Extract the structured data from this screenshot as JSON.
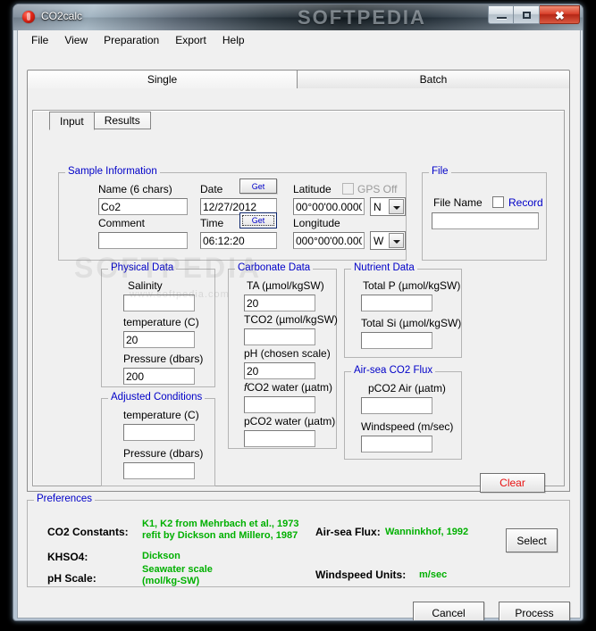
{
  "window": {
    "title": "CO2calc",
    "watermark": "SOFTPEDIA",
    "body_watermark": "SOFTPEDIA",
    "body_watermark_sub": "www.softpedia.com",
    "minimize_label": "–",
    "maximize_label": "□",
    "close_label": "✖"
  },
  "menu": {
    "items": [
      {
        "label": "File"
      },
      {
        "label": "View"
      },
      {
        "label": "Preparation"
      },
      {
        "label": "Export"
      },
      {
        "label": "Help"
      }
    ]
  },
  "outer_tabs": [
    {
      "label": "Single",
      "active": true
    },
    {
      "label": "Batch",
      "active": false
    }
  ],
  "inner_tabs": [
    {
      "label": "Input",
      "active": true
    },
    {
      "label": "Results",
      "active": false
    }
  ],
  "sample_information": {
    "title": "Sample Information",
    "name_label": "Name (6 chars)",
    "name_value": "Co2",
    "comment_label": "Comment",
    "comment_value": "",
    "date_label": "Date",
    "date_value": "12/27/2012",
    "date_get_label": "Get",
    "time_label": "Time",
    "time_value": "06:12:20",
    "time_get_label": "Get",
    "latitude_label": "Latitude",
    "latitude_value": "00°00'00.0000\"",
    "latitude_hemisphere": "N",
    "longitude_label": "Longitude",
    "longitude_value": "000°00'00.0000\"",
    "longitude_hemisphere": "W",
    "gps_label": "GPS Off"
  },
  "file_section": {
    "title": "File",
    "file_name_label": "File Name",
    "record_label": "Record",
    "file_name_value": ""
  },
  "physical_data": {
    "title": "Physical Data",
    "salinity_label": "Salinity",
    "salinity_value": "",
    "temperature_label": "temperature (C)",
    "temperature_value": "20",
    "pressure_label": "Pressure (dbars)",
    "pressure_value": "200"
  },
  "adjusted_conditions": {
    "title": "Adjusted  Conditions",
    "temperature_label": "temperature (C)",
    "temperature_value": "",
    "pressure_label": "Pressure (dbars)",
    "pressure_value": ""
  },
  "carbonate_data": {
    "title": "Carbonate Data",
    "ta_label": "TA (µmol/kgSW)",
    "ta_value": "20",
    "tco2_label": "TCO2 (µmol/kgSW)",
    "tco2_value": "",
    "ph_label": "pH (chosen scale)",
    "ph_value": "20",
    "fco2_label_prefix": "f",
    "fco2_label_rest": "CO2 water (µatm)",
    "fco2_value": "",
    "pco2_label": "pCO2 water (µatm)",
    "pco2_value": ""
  },
  "nutrient_data": {
    "title": "Nutrient Data",
    "total_p_label": "Total P (µmol/kgSW)",
    "total_p_value": "",
    "total_si_label": "Total Si (µmol/kgSW)",
    "total_si_value": ""
  },
  "air_sea_flux": {
    "title": "Air-sea CO2 Flux",
    "pco2_air_label": "pCO2 Air (µatm)",
    "pco2_air_value": "",
    "windspeed_label": "Windspeed (m/sec)",
    "windspeed_value": ""
  },
  "clear_button": {
    "label": "Clear"
  },
  "preferences": {
    "title": "Preferences",
    "co2_constants_label": "CO2 Constants:",
    "co2_constants_value": "K1, K2 from Mehrbach et al., 1973\nrefit by Dickson and Millero, 1987",
    "khso4_label": "KHSO4:",
    "khso4_value": "Dickson",
    "ph_scale_label": "pH Scale:",
    "ph_scale_value": "Seawater scale\n(mol/kg-SW)",
    "air_sea_flux_label": "Air-sea Flux:",
    "air_sea_flux_value": "Wanninkhof, 1992",
    "windspeed_units_label": "Windspeed Units:",
    "windspeed_units_value": "m/sec",
    "select_label": "Select"
  },
  "footer": {
    "cancel_label": "Cancel",
    "process_label": "Process"
  },
  "colors": {
    "group_title": "#0000c8",
    "pref_value": "#00b000",
    "clear_text": "#e81010",
    "window_bg": "#f0f0f0"
  }
}
